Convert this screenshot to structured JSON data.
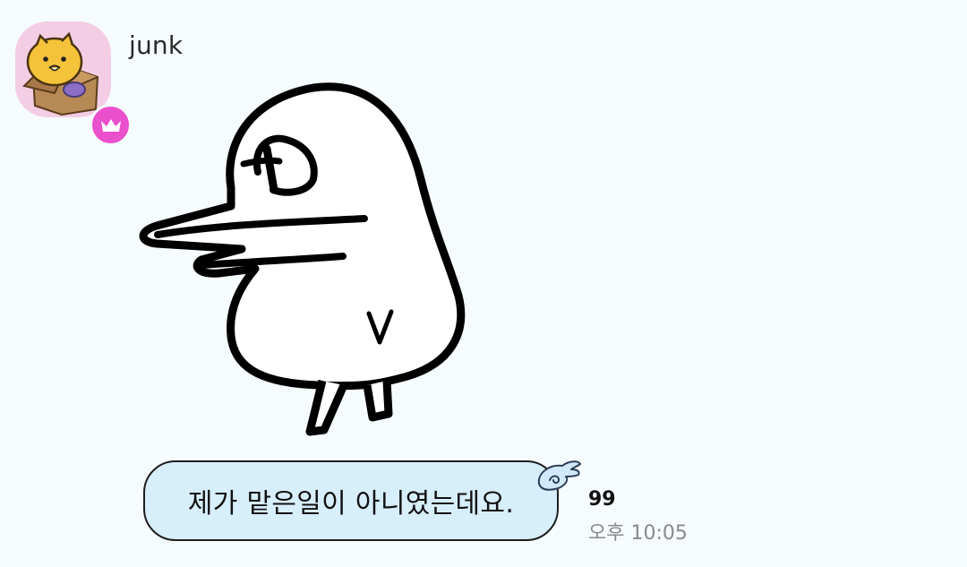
{
  "message": {
    "sender": "junk",
    "text": "제가 맡은일이 아니였는데요.",
    "unread": "99",
    "time": "오후 10:05"
  },
  "avatar": {
    "icon": "lion-in-box-avatar",
    "badge_icon": "crown-icon",
    "badge_color": "#ea4fcc"
  },
  "sticker": {
    "icon": "duck-sticker"
  },
  "bubble": {
    "fill": "#d7eefb",
    "decoration_icon": "angel-wing-icon"
  }
}
